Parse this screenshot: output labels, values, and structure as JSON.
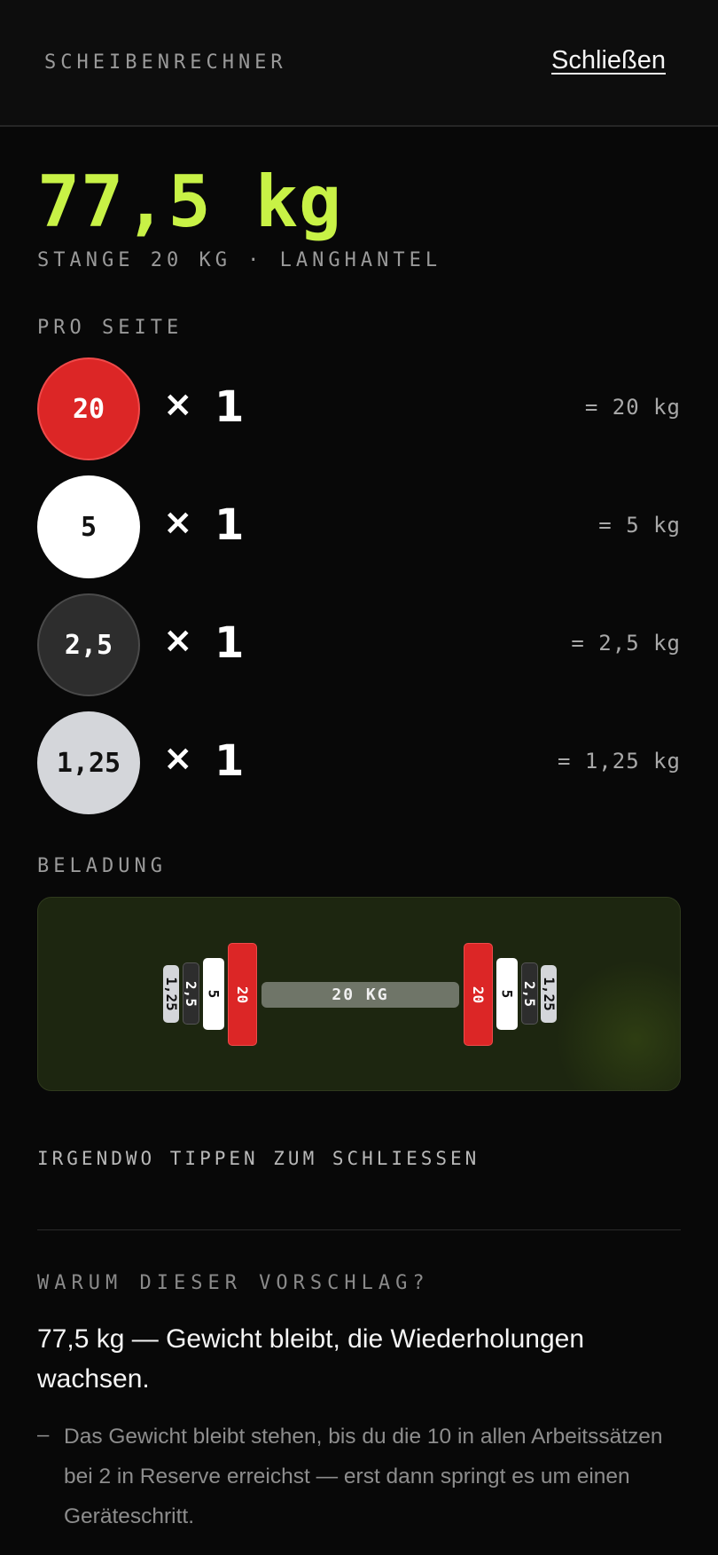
{
  "header": {
    "title": "SCHEIBENRECHNER",
    "close_label": "Schließen"
  },
  "summary": {
    "total": "77,5 kg",
    "bar_info": "STANGE 20 KG · LANGHANTEL"
  },
  "per_side": {
    "label": "PRO SEITE",
    "times_symbol": "×",
    "plates": [
      {
        "weight": "20",
        "count": "1",
        "subtotal": "= 20 kg",
        "color": "#dc2626"
      },
      {
        "weight": "5",
        "count": "1",
        "subtotal": "= 5 kg",
        "color": "#ffffff"
      },
      {
        "weight": "2,5",
        "count": "1",
        "subtotal": "= 2,5 kg",
        "color": "#2d2d2d"
      },
      {
        "weight": "1,25",
        "count": "1",
        "subtotal": "= 1,25 kg",
        "color": "#d4d6da"
      }
    ]
  },
  "loading": {
    "label": "BELADUNG",
    "bar_label": "20 KG",
    "left_plates": [
      "1,25",
      "2,5",
      "5",
      "20"
    ],
    "right_plates": [
      "20",
      "5",
      "2,5",
      "1,25"
    ]
  },
  "hint": "IRGENDWO TIPPEN ZUM SCHLIESSEN",
  "why": {
    "label": "WARUM DIESER VORSCHLAG?",
    "headline": "77,5 kg — Gewicht bleibt, die Wiederholungen wachsen.",
    "bullet_marker": "–",
    "bullet": "Das Gewicht bleibt stehen, bis du die 10 in allen Arbeitssätzen bei 2 in Reserve erreichst — erst dann springt es um einen Geräteschritt."
  }
}
